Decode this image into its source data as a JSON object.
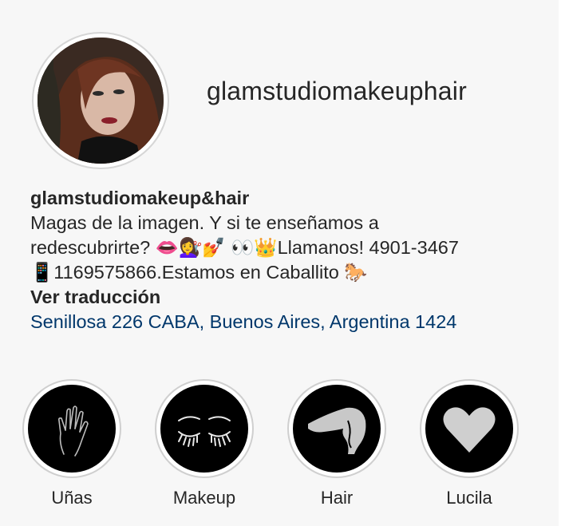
{
  "profile": {
    "username": "glamstudiomakeuphair",
    "display_name": "glamstudiomakeup&hair",
    "bio_lines": [
      "Magas de la imagen.  Y si te enseñamos a",
      "redescubrirte? 👄💇‍♀️💅 👀👑Llamanos! 4901-3467",
      "📱1169575866.Estamos en Caballito 🐎"
    ],
    "translate_label": "Ver traducción",
    "address": "Senillosa 226 CABA, Buenos Aires, Argentina 1424"
  },
  "highlights": [
    {
      "label": "Uñas",
      "icon": "hand-nails-icon"
    },
    {
      "label": "Makeup",
      "icon": "eyelashes-icon"
    },
    {
      "label": "Hair",
      "icon": "hair-silhouette-icon"
    },
    {
      "label": "Lucila",
      "icon": "heart-icon"
    }
  ]
}
